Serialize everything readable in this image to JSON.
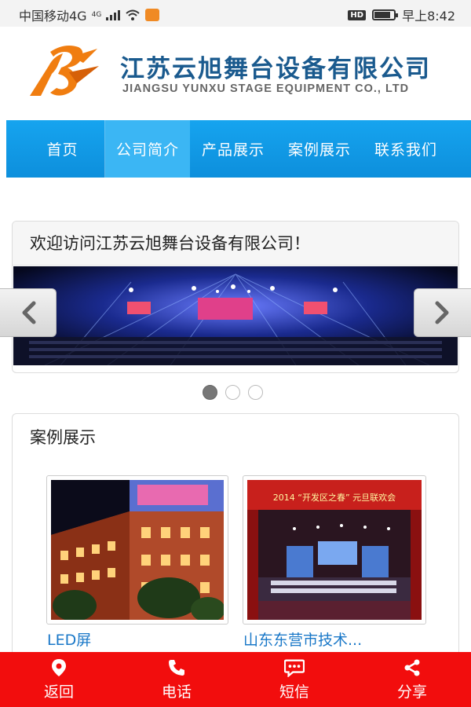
{
  "status_bar": {
    "carrier": "中国移动4G",
    "network_badge": "4G",
    "hd_badge": "HD",
    "time": "早上8:42",
    "battery_level": 0.85
  },
  "header": {
    "company_name_cn": "江苏云旭舞台设备有限公司",
    "company_name_en": "JIANGSU YUNXU STAGE EQUIPMENT CO., LTD",
    "logo_icon": "yunxu-logo-icon",
    "brand_color": "#1a5a8e",
    "logo_color": "#f07d10"
  },
  "nav": {
    "items": [
      {
        "label": "首页"
      },
      {
        "label": "公司简介"
      },
      {
        "label": "产品展示"
      },
      {
        "label": "案例展示"
      },
      {
        "label": "联系我们"
      }
    ],
    "active_index": 1,
    "color": "#16a4ef"
  },
  "welcome": {
    "title": "欢迎访问江苏云旭舞台设备有限公司！",
    "slider": {
      "prev_icon": "chevron-left-icon",
      "next_icon": "chevron-right-icon",
      "slide_count": 3,
      "active_slide": 0
    }
  },
  "cases": {
    "title": "案例展示",
    "items": [
      {
        "label": "LED屏"
      },
      {
        "label": "山东东营市技术..."
      }
    ],
    "case2_banner": "2014 “开发区之春” 元旦联欢会"
  },
  "bottom_bar": {
    "color": "#f20d0d",
    "items": [
      {
        "label": "返回",
        "icon": "location-pin-icon"
      },
      {
        "label": "电话",
        "icon": "phone-icon"
      },
      {
        "label": "短信",
        "icon": "message-icon"
      },
      {
        "label": "分享",
        "icon": "share-icon"
      }
    ]
  }
}
